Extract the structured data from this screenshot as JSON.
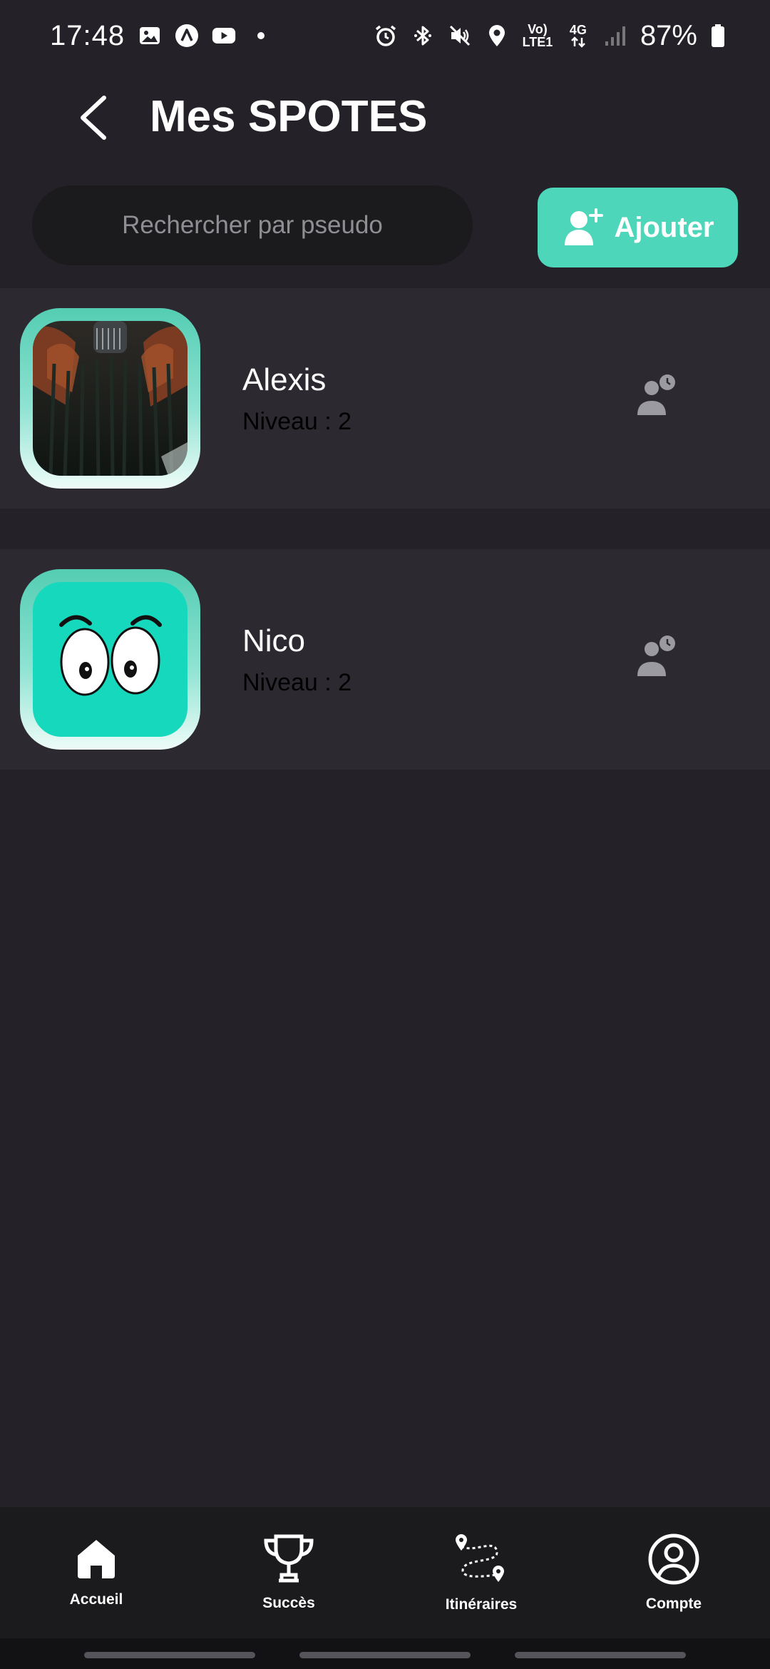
{
  "status_bar": {
    "time": "17:48",
    "battery": "87%",
    "network_top": "Vo)",
    "network_bottom": "LTE1",
    "signal_label": "4G",
    "left_icons": [
      "image-icon",
      "app-a-icon",
      "youtube-icon",
      "dot-icon"
    ],
    "right_icons": [
      "alarm-icon",
      "bluetooth-icon",
      "mute-icon",
      "location-icon",
      "volte-icon",
      "4g-icon",
      "signal-icon",
      "battery-icon"
    ]
  },
  "header": {
    "title": "Mes SPOTES",
    "back_icon": "back-arrow-icon"
  },
  "search": {
    "placeholder": "Rechercher par pseudo",
    "value": ""
  },
  "add_button": {
    "label": "Ajouter",
    "icon": "add-user-icon"
  },
  "friends": [
    {
      "name": "Alexis",
      "level": "Niveau : 2",
      "avatar": "photo-avatar",
      "action_icon": "friend-pending-icon"
    },
    {
      "name": "Nico",
      "level": "Niveau : 2",
      "avatar": "eyes-avatar",
      "action_icon": "friend-pending-icon"
    }
  ],
  "nav": {
    "items": [
      {
        "label": "Accueil",
        "icon": "home-icon"
      },
      {
        "label": "Succès",
        "icon": "trophy-icon"
      },
      {
        "label": "Itinéraires",
        "icon": "route-icon"
      },
      {
        "label": "Compte",
        "icon": "account-icon"
      }
    ]
  },
  "colors": {
    "background": "#242128",
    "row": "#2c2a30",
    "accent": "#4dd6b9",
    "nav": "#1b1a1d"
  }
}
